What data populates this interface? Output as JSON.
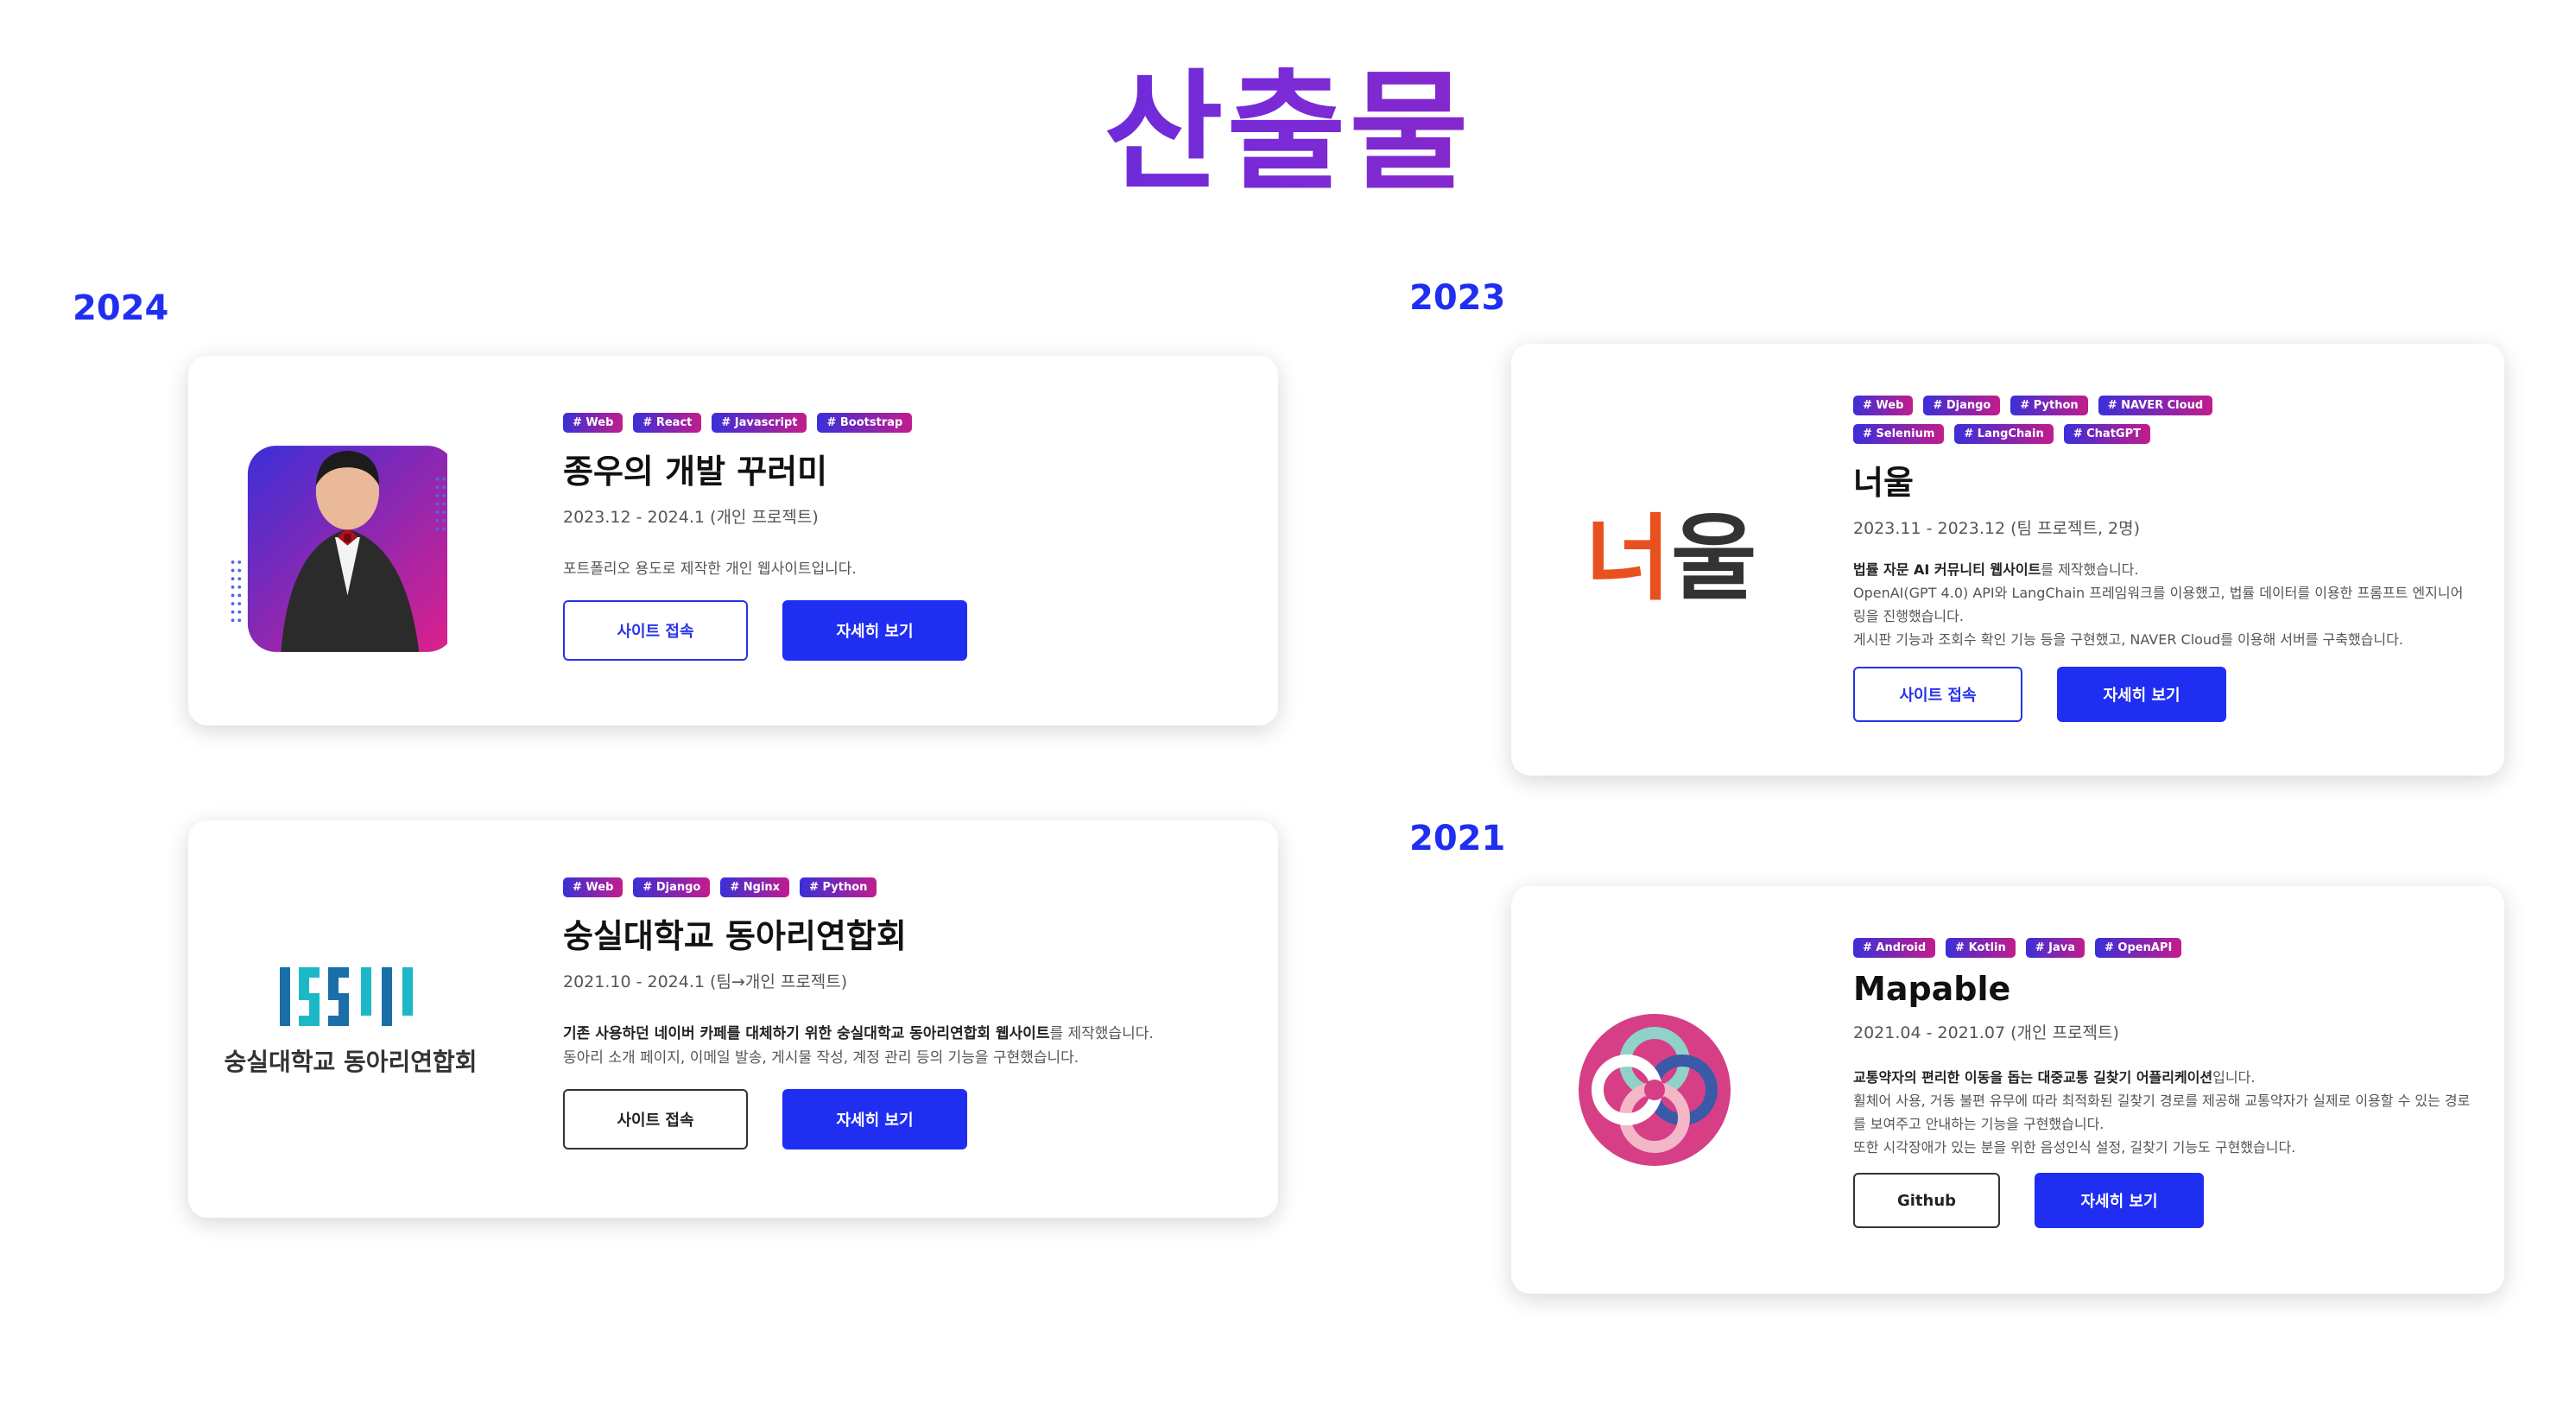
{
  "page": {
    "title": "산출물"
  },
  "years": {
    "left_top": "2024",
    "right_top": "2023",
    "right_bottom": "2021"
  },
  "projects": [
    {
      "tags": [
        "# Web",
        "# React",
        "# Javascript",
        "# Bootstrap"
      ],
      "title": "종우의 개발 꾸러미",
      "date": "2023.12 - 2024.1 (개인 프로젝트)",
      "desc": "포트폴리오 용도로 제작한 개인 웹사이트입니다.",
      "btn1": "사이트 접속",
      "btn2": "자세히 보기",
      "thumb": "portrait-photo"
    },
    {
      "tags": [
        "# Web",
        "# Django",
        "# Nginx",
        "# Python"
      ],
      "title": "숭실대학교 동아리연합회",
      "date": "2021.10 - 2024.1 (팀→개인 프로젝트)",
      "desc_bold": "기존 사용하던 네이버 카페를 대체하기 위한 숭실대학교 동아리연합회 웹사이트",
      "desc_rest": "를 제작했습니다.",
      "desc2": "동아리 소개 페이지, 이메일 발송, 게시물 작성, 계정 관리 등의 기능을 구현했습니다.",
      "btn1": "사이트 접속",
      "btn2": "자세히 보기",
      "logo_text": "숭실대학교 동아리연합회"
    },
    {
      "tags": [
        "# Web",
        "# Django",
        "# Python",
        "# NAVER Cloud",
        "# Selenium",
        "# LangChain",
        "# ChatGPT"
      ],
      "title": "너울",
      "date": "2023.11 - 2023.12 (팀 프로젝트, 2명)",
      "desc_bold": "법률 자문 AI 커뮤니티 웹사이트",
      "desc_rest": "를 제작했습니다.",
      "desc2": "OpenAI(GPT 4.0) API와 LangChain 프레임워크를 이용했고, 법률 데이터를 이용한 프롬프트 엔지니어링을 진행했습니다.",
      "desc3": "게시판 기능과 조회수 확인 기능 등을 구현했고, NAVER Cloud를 이용해 서버를 구축했습니다.",
      "btn1": "사이트 접속",
      "btn2": "자세히 보기",
      "logo_a": "너",
      "logo_b": "울"
    },
    {
      "tags": [
        "# Android",
        "# Kotlin",
        "# Java",
        "# OpenAPI"
      ],
      "title": "Mapable",
      "date": "2021.04 - 2021.07 (개인 프로젝트)",
      "desc_bold": "교통약자의 편리한 이동을 돕는 대중교통 길찾기 어플리케이션",
      "desc_rest": "입니다.",
      "desc2": "휠체어 사용, 거동 불편 유무에 따라 최적화된 길찾기 경로를 제공해 교통약자가 실제로 이용할 수 있는 경로를 보여주고 안내하는 기능을 구현했습니다.",
      "desc3": "또한 시각장애가 있는 분을 위한 음성인식 설정, 길찾기 기능도 구현했습니다.",
      "btn1": "Github",
      "btn2": "자세히 보기"
    }
  ],
  "colors": {
    "accent": "#1f2ef0",
    "tag_start": "#3b2fd8",
    "tag_end": "#c21d8c",
    "logo_orange": "#e8511f",
    "logo_dark": "#333333",
    "ssu_blue": "#1a6fa8",
    "ssu_teal": "#1cb8c8",
    "mapable_pink": "#d63f86"
  }
}
